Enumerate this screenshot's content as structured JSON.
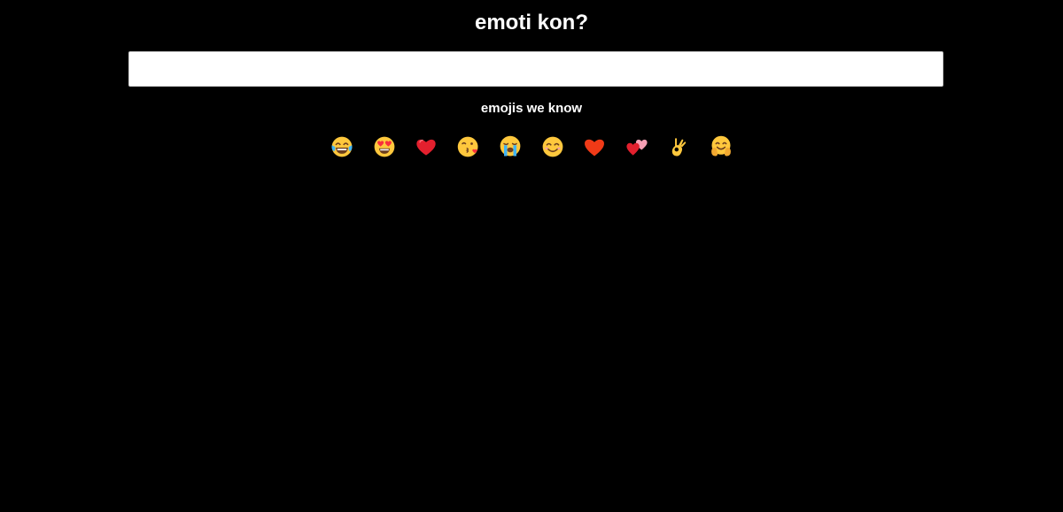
{
  "header": {
    "title": "emoti kon?"
  },
  "search": {
    "value": "",
    "placeholder": ""
  },
  "known_emojis": {
    "heading": "emojis we know",
    "items": [
      {
        "name": "face-with-tears-of-joy",
        "char": "😂"
      },
      {
        "name": "smiling-face-with-heart-eyes",
        "char": "😍"
      },
      {
        "name": "red-heart",
        "char": "❤️"
      },
      {
        "name": "face-blowing-a-kiss",
        "char": "😘"
      },
      {
        "name": "loudly-crying-face",
        "char": "😭"
      },
      {
        "name": "smiling-face-with-smiling-eyes",
        "char": "😊"
      },
      {
        "name": "red-heart-suit",
        "char": "♥️"
      },
      {
        "name": "two-hearts",
        "char": "💕"
      },
      {
        "name": "ok-hand",
        "char": "👌"
      },
      {
        "name": "hugging-face",
        "char": "🤗"
      }
    ]
  },
  "colors": {
    "background": "#000000",
    "text": "#ffffff",
    "input_background": "#ffffff",
    "emoji_yellow": "#FFC83D",
    "emoji_red": "#F92F3C",
    "emoji_blue": "#41B4F4"
  }
}
